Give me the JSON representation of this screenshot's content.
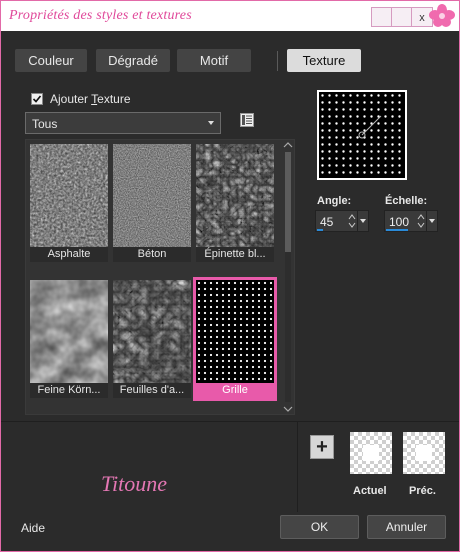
{
  "window": {
    "title": "Propriétés des styles et textures",
    "close_glyph": "x",
    "flower_icon": "flower-icon",
    "accent": "#e85aaa"
  },
  "tabs": [
    {
      "label": "Couleur",
      "active": false
    },
    {
      "label": "Dégradé",
      "active": false
    },
    {
      "label": "Motif",
      "active": false
    },
    {
      "label": "Texture",
      "active": true
    }
  ],
  "texture": {
    "checkbox_label_prefix": "Ajouter ",
    "checkbox_label_accel": "T",
    "checkbox_label_suffix": "exture",
    "checked": true,
    "category": "Tous",
    "items": [
      {
        "caption": "Asphalte",
        "selected": false
      },
      {
        "caption": "Béton",
        "selected": false
      },
      {
        "caption": "Épinette bl...",
        "selected": false
      },
      {
        "caption": "Feine Körn...",
        "selected": false
      },
      {
        "caption": "Feuilles d'a...",
        "selected": false
      },
      {
        "caption": "Grille",
        "selected": true
      }
    ]
  },
  "params": {
    "angle_label": "Angle:",
    "angle_value": "45",
    "scale_label": "Échelle:",
    "scale_value": "100"
  },
  "bottom": {
    "signature": "Titoune",
    "current_label": "Actuel",
    "previous_label": "Préc.",
    "plus_glyph": "+"
  },
  "footer": {
    "help": "Aide",
    "ok": "OK",
    "cancel": "Annuler"
  }
}
